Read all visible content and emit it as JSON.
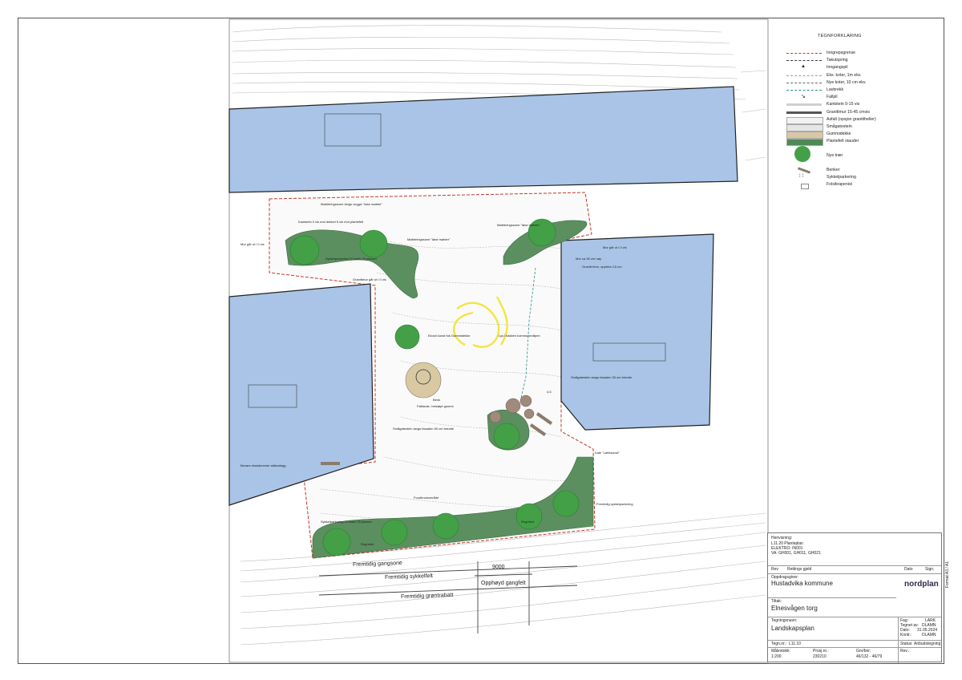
{
  "legend": {
    "title": "TEGNFORKLARING",
    "items": [
      {
        "label": "Inngrepsgrense",
        "kind": "dash",
        "color": "#c0392b"
      },
      {
        "label": "Takutspring",
        "kind": "dash",
        "color": "#334"
      },
      {
        "label": "Inngangspil",
        "kind": "tri",
        "color": "#222"
      },
      {
        "label": "Eks. koter, 1m ekv.",
        "kind": "dash",
        "color": "#999"
      },
      {
        "label": "Nye koter, 10 cm ekv.",
        "kind": "dash",
        "color": "#666"
      },
      {
        "label": "Lavbrekk",
        "kind": "dash",
        "color": "#2a8c8c"
      },
      {
        "label": "Fallpil",
        "kind": "arrow",
        "color": "#444"
      },
      {
        "label": "Kantstein 0-15 vis",
        "kind": "bar",
        "color": "#cfcfcf"
      },
      {
        "label": "Granittmur 15-45 cmvis",
        "kind": "bar",
        "color": "#555"
      },
      {
        "label": "Asfalt (opsjon granittheller)",
        "kind": "fill",
        "color": "#f2f2f2"
      },
      {
        "label": "Smågatestein",
        "kind": "fill",
        "color": "#e6e6e6"
      },
      {
        "label": "Gummidekke",
        "kind": "fill",
        "color": "#d9c9a3"
      },
      {
        "label": "Plantefelt stauder",
        "kind": "fill",
        "color": "#4f8a55"
      },
      {
        "label": "Nye trær",
        "kind": "tree",
        "color": "#43a047"
      },
      {
        "label": "Benker",
        "kind": "bench",
        "color": "#8b7b6b"
      },
      {
        "label": "Sykkelparkering",
        "kind": "bike",
        "color": "#444"
      },
      {
        "label": "Folsikrapenist",
        "kind": "grate",
        "color": "#888"
      }
    ]
  },
  "map_labels": {
    "top_zone": "Møbleringssone langs veggiv \"løse møbler\"",
    "mur_left": "Mur går ut i 0 vis",
    "kantstein_top": "Kantstein 0 vis mot dekket 5 vis mot plantefelt",
    "mob_left": "Møbleringssone \"løse møbler\"",
    "mob_right": "Møbleringssone \"løse møbler\"",
    "bike_top": "Sykkelparkering 10 stativ 20 plasser",
    "granitt_mid": "Granittmur går ut i 0 vis",
    "lys": "Lys i bakken kommunevåpen",
    "rubber": "Ekosil kunst fok Gummidekke",
    "falleskole": "Fallskole- helstøpt gummi",
    "bench": "Benk",
    "smaa_left": "Smågatestein langs fasaden 50 cm bredde",
    "bevare": "Bevare eksisterende skiltanlegg",
    "smaa_right": "Smågatestein langs fasaden 50 cm bredde",
    "mur_right": "Mur ca 45 cm høy",
    "granitt_trinn": "Granitt trinn, opptrinn 15 cm",
    "mur_right2": "Mur går ut i 0 vis",
    "kafe": "Kafé \"Løftekunst\"",
    "sykkel_right": "Fremtidig sykkelparkering",
    "food": "Foodtruckområde",
    "bike_bottom": "Sykkelparkering 10 stativ 20 plasser",
    "regnbed_l": "Regnbed",
    "regnbed_r": "Regnbed",
    "gangsone": "Fremtidig gangsone",
    "sykkelfelt": "Fremtidig sykkelfelt",
    "gronn": "Fremtidig grøntrabatt",
    "gangfelt": "Opphøyd gangfelt",
    "dim": "9000",
    "dim_small": "4,5"
  },
  "title_block": {
    "henvisning_label": "Henvisning:",
    "henvisning_lines": [
      "L11.20 Planteplan",
      "ELEKTRO: IN001",
      "VA: GH001, GH011, GH021"
    ],
    "rev": "Rev",
    "rev_desc": "Rettings gjeld",
    "dato": "Dato",
    "sign": "Sign.",
    "oppdragsgiver_label": "Oppdragsgiver:",
    "oppdragsgiver": "Hustadvika kommune",
    "tiltak_label": "Tiltak:",
    "tiltak": "Elnesvågen torg",
    "tegningsnavn_label": "Tegningsnavn:",
    "tegningsnavn": "Landskapsplan",
    "tegn_nr_label": "Tegn.nr.:",
    "tegn_nr": "L11.10",
    "malestokk_label": "Målestokk:",
    "malestokk": "1:200",
    "prosj_label": "Prosj.nr.:",
    "prosj": "230210",
    "grid_label": "Gnr/bnr:",
    "grid": "46/132 - 46/79",
    "fag_label": "Fag:",
    "fag": "LARK",
    "tegnet_label": "Tegnet av:",
    "tegnet": "DLAMN",
    "dato2_label": "Dato:",
    "dato2": "31.05.2024",
    "kontr_label": "Kontr.:",
    "kontr": "DLAMN",
    "status_label": "Status:",
    "status": "Anbudstegning",
    "rev2_label": "Rev.:",
    "company": "nordplan",
    "side_text": "Format A3 / A1"
  }
}
